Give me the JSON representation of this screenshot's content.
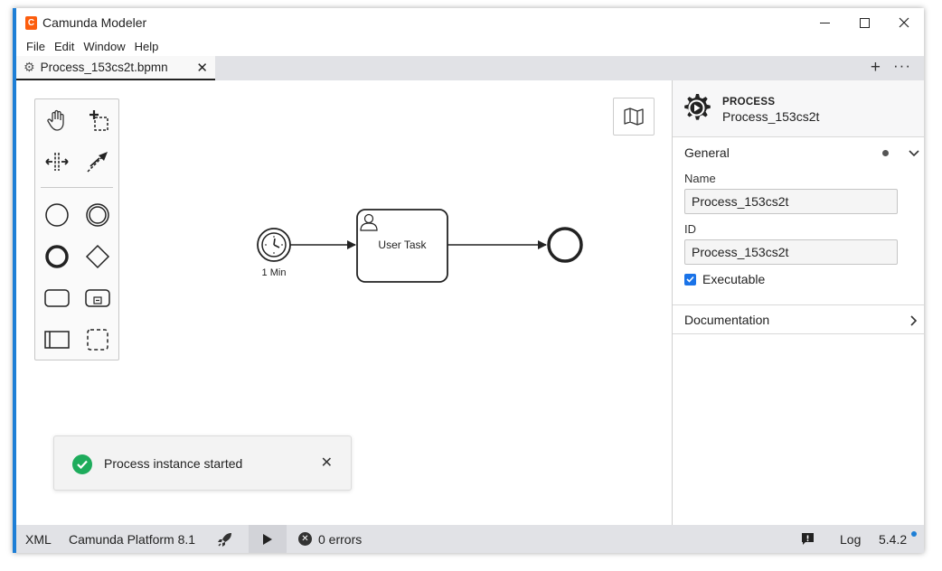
{
  "window": {
    "title": "Camunda Modeler",
    "app_icon_glyph": "C"
  },
  "menu": [
    "File",
    "Edit",
    "Window",
    "Help"
  ],
  "tabs": [
    {
      "title": "Process_153cs2t.bpmn",
      "active": true
    }
  ],
  "tab_actions": {
    "add": "+",
    "more": "···"
  },
  "palette": {
    "tools": [
      "hand-tool",
      "lasso-tool",
      "space-tool",
      "global-connect-tool",
      "start-event",
      "intermediate-event",
      "end-event",
      "gateway",
      "task",
      "subprocess",
      "pool",
      "group"
    ]
  },
  "diagram": {
    "start_event_label": "1 Min",
    "task_label": "User Task"
  },
  "toast": {
    "message": "Process instance started",
    "close": "✕"
  },
  "properties_panel": {
    "element_type": "PROCESS",
    "element_name": "Process_153cs2t",
    "groups": {
      "general": {
        "title": "General",
        "name_label": "Name",
        "name_value": "Process_153cs2t",
        "id_label": "ID",
        "id_value": "Process_153cs2t",
        "executable_label": "Executable",
        "executable_checked": true
      },
      "documentation": {
        "title": "Documentation"
      }
    }
  },
  "statusbar": {
    "xml": "XML",
    "platform": "Camunda Platform 8.1",
    "errors": "0 errors",
    "log": "Log",
    "version": "5.4.2"
  },
  "colors": {
    "accent": "#1e7fd6",
    "brand": "#fc5d0d",
    "success": "#1eac5c",
    "checkbox": "#1a73e8"
  }
}
